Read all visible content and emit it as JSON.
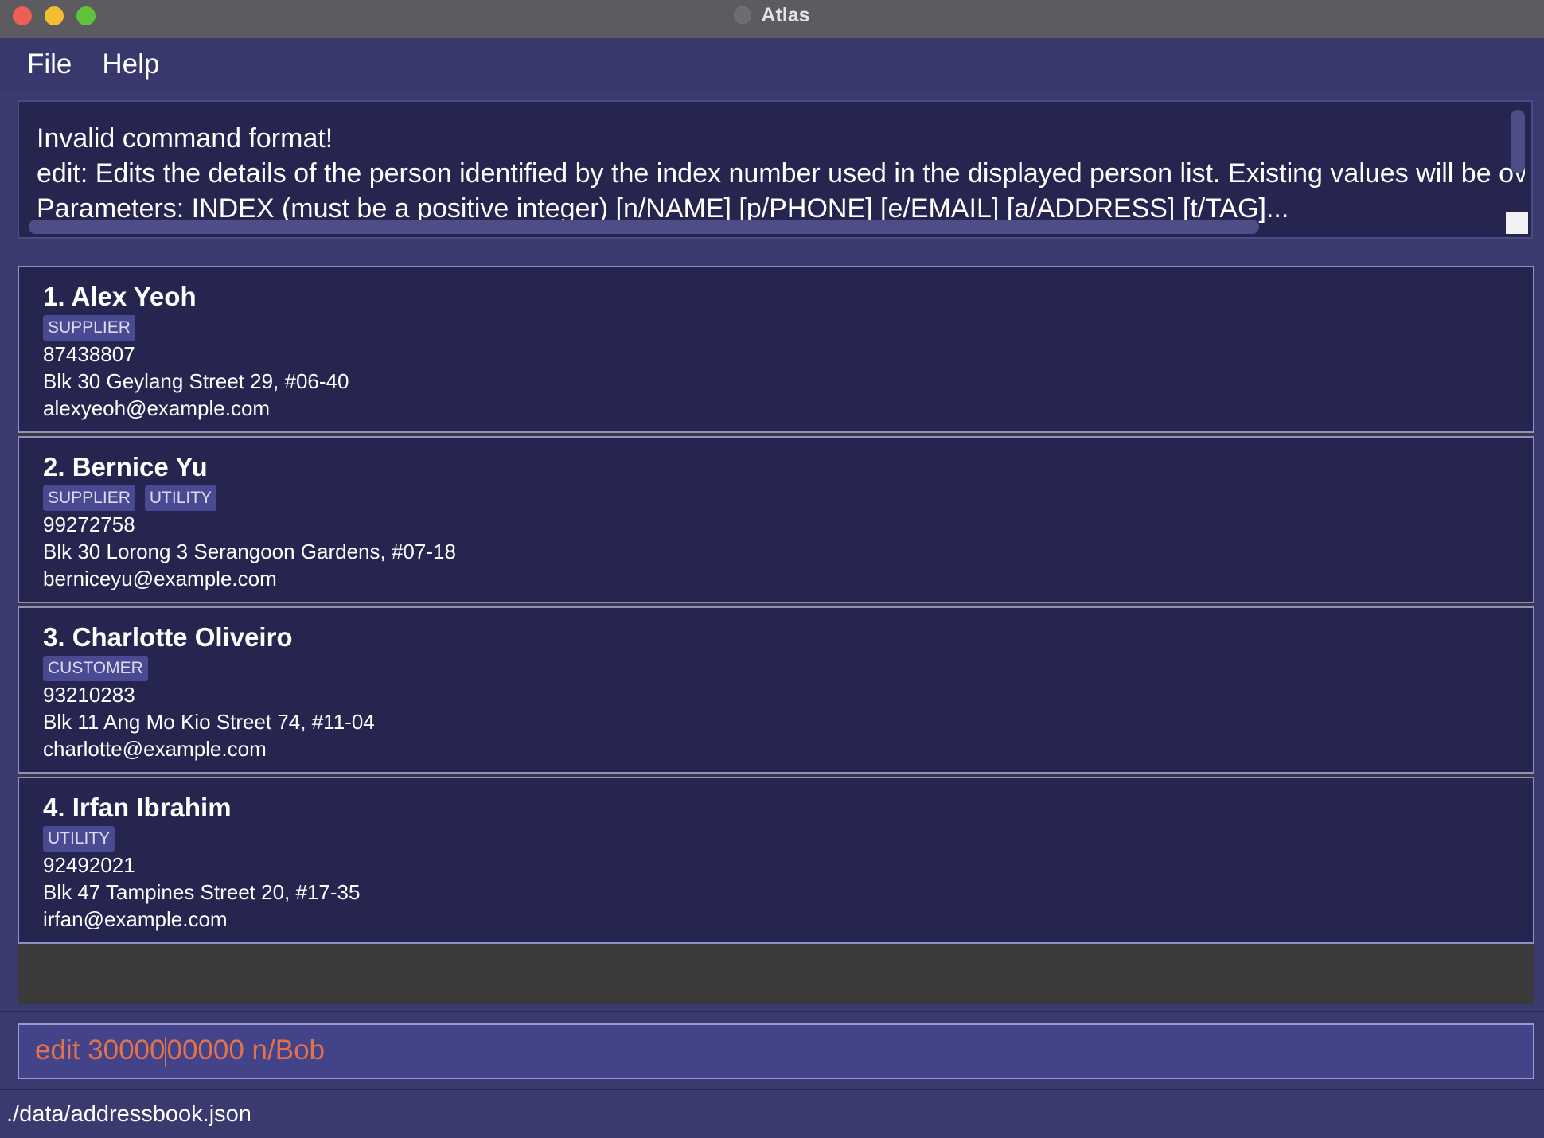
{
  "window": {
    "title": "Atlas"
  },
  "menu": {
    "items": [
      {
        "label": "File"
      },
      {
        "label": "Help"
      }
    ]
  },
  "result": {
    "lines": [
      "Invalid command format!",
      "edit: Edits the details of the person identified by the index number used in the displayed person list. Existing values will be overwri",
      "Parameters: INDEX (must be a positive integer) [n/NAME] [p/PHONE] [e/EMAIL] [a/ADDRESS] [t/TAG]..."
    ]
  },
  "persons": [
    {
      "name": "1. Alex Yeoh",
      "tags": [
        "SUPPLIER"
      ],
      "phone": "87438807",
      "address": "Blk 30 Geylang Street 29, #06-40",
      "email": "alexyeoh@example.com"
    },
    {
      "name": "2. Bernice Yu",
      "tags": [
        "SUPPLIER",
        "UTILITY"
      ],
      "phone": "99272758",
      "address": "Blk 30 Lorong 3 Serangoon Gardens, #07-18",
      "email": "berniceyu@example.com"
    },
    {
      "name": "3. Charlotte Oliveiro",
      "tags": [
        "CUSTOMER"
      ],
      "phone": "93210283",
      "address": "Blk 11 Ang Mo Kio Street 74, #11-04",
      "email": "charlotte@example.com"
    },
    {
      "name": "4. Irfan Ibrahim",
      "tags": [
        "UTILITY"
      ],
      "phone": "92492021",
      "address": "Blk 47 Tampines Street 20, #17-35",
      "email": "irfan@example.com"
    }
  ],
  "command": {
    "before_caret": "edit 30000",
    "after_caret": "00000 n/Bob"
  },
  "status": {
    "file_path": "./data/addressbook.json"
  },
  "colors": {
    "background": "#3b3a6e",
    "card": "#25254f",
    "tag": "#4a4a93",
    "command_error_text": "#e4714d"
  }
}
